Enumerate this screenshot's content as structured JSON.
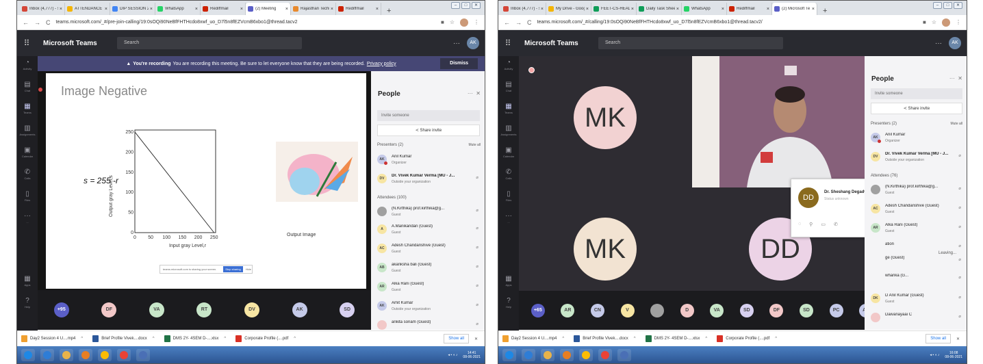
{
  "left": {
    "tabs": [
      {
        "label": "Inbox (4,777) - s",
        "color": "#d44638"
      },
      {
        "label": "ATTENDANCE S",
        "color": "#f4b400"
      },
      {
        "label": "DIP SESSION 2(",
        "color": "#4285f4"
      },
      {
        "label": "WhatsApp",
        "color": "#25d366"
      },
      {
        "label": "Rediffmail",
        "color": "#cc2200"
      },
      {
        "label": "(2) Meeting",
        "color": "#5b5fc7",
        "active": true
      },
      {
        "label": "Rajasthan Techi",
        "color": "#e88a2e"
      },
      {
        "label": "Rediffmail",
        "color": "#cc2200"
      }
    ],
    "url": "teams.microsoft.com/_#/pre-join-calling/19:0sOQi90NeBfFHTHcdo8xwf_uo_D7l5n8fEZVcmB6xbo1@thread.tacv2",
    "brand": "Microsoft Teams",
    "search": "Search",
    "me": "AK",
    "rail": [
      "Activity",
      "Chat",
      "Teams",
      "Assignments",
      "Calendar",
      "Calls",
      "Files",
      "...",
      "Apps",
      "Help"
    ],
    "banner": {
      "strong": "You're recording",
      "text": "You are recording this meeting. Be sure to let everyone know that they are being recorded.",
      "link": "Privacy policy",
      "dismiss": "Dismiss"
    },
    "slide": {
      "title": "Image Negative",
      "formula": "s = 255 -r",
      "xlabel": "Input gray Level,r",
      "ylabel": "Output gray Level,s",
      "output_caption": "Output Image",
      "share_text": "teams.microsoft.com is sharing your screen.",
      "stop": "Stop sharing",
      "hide": "Hide"
    },
    "chart_data": {
      "type": "line",
      "x": [
        0,
        250
      ],
      "y": [
        250,
        0
      ],
      "xticks": [
        "0",
        "50",
        "100",
        "150",
        "200",
        "250"
      ],
      "yticks": [
        "0",
        "50",
        "100",
        "150",
        "200",
        "250"
      ],
      "xlabel": "Input gray Level,r",
      "ylabel": "Output gray Level,s",
      "xlim": [
        0,
        255
      ],
      "ylim": [
        0,
        255
      ]
    },
    "avatars": [
      {
        "t": "+95",
        "c": "#5b5fc7"
      },
      {
        "t": "DF",
        "c": "#f2c8c8"
      },
      {
        "t": "VA",
        "c": "#c8e6c9"
      },
      {
        "t": "RT",
        "c": "#c8e6c9"
      },
      {
        "t": "DV",
        "c": "#f7e5a3"
      },
      {
        "t": "AK",
        "c": "#c5cae9"
      },
      {
        "t": "SD",
        "c": "#d7d0f0"
      }
    ],
    "people": {
      "title": "People",
      "invite": "Invite someone",
      "share": "Share invite",
      "presenters": "Presenters (2)",
      "muteall": "Mute all",
      "attendees": "Attendees (100)",
      "list": [
        {
          "i": "AK",
          "n": "Anil Kumar",
          "s": "Organizer",
          "c": "#c5cae9"
        },
        {
          "i": "DV",
          "n": "Dr. Vivek Kumar Verma [MU - J...",
          "s": "Outside your organization",
          "c": "#f7e5a3"
        },
        {
          "i": "",
          "n": "(N.Kirthika) prof.kirthika@g...",
          "s": "Guest",
          "c": "#a0a0a0"
        },
        {
          "i": "A",
          "n": "A.Manikandan (Guest)",
          "s": "Guest",
          "c": "#f7e5a3"
        },
        {
          "i": "AC",
          "n": "Adesh Chandanshive (Guest)",
          "s": "Guest",
          "c": "#f7e5a3"
        },
        {
          "i": "AB",
          "n": "akanksha bali (Guest)",
          "s": "Guest",
          "c": "#c8e6c9"
        },
        {
          "i": "AR",
          "n": "Alka Rani (Guest)",
          "s": "Guest",
          "c": "#c8e6c9"
        },
        {
          "i": "AK",
          "n": "Amit Kumar",
          "s": "Outside your organization",
          "c": "#c5cae9"
        },
        {
          "i": "",
          "n": "ankita sonam (Guest)",
          "s": "",
          "c": "#f2c8c8"
        }
      ]
    },
    "downloads": [
      {
        "n": "Day2 Session 4 U....mp4",
        "c": "#f0a030"
      },
      {
        "n": "Brief Profile Vivek....docx",
        "c": "#2b579a"
      },
      {
        "n": "DMS 2Y- 4SEM D-....xlsx",
        "c": "#217346"
      },
      {
        "n": "Corporate Profile (....pdf",
        "c": "#d93025"
      }
    ],
    "showall": "Show all",
    "clock": {
      "time": "14:41",
      "date": "08-06-2021"
    }
  },
  "right": {
    "tabs": [
      {
        "label": "Inbox (4,777) - sand",
        "color": "#d44638"
      },
      {
        "label": "My Drive - Google",
        "color": "#f4b400"
      },
      {
        "label": "FEET-CS-HEADCOU",
        "color": "#0f9d58"
      },
      {
        "label": "Daily Task Sheet(2",
        "color": "#0f9d58"
      },
      {
        "label": "WhatsApp",
        "color": "#25d366"
      },
      {
        "label": "Rediffmail",
        "color": "#cc2200"
      },
      {
        "label": "(2) Microsoft Te",
        "color": "#5b5fc7",
        "active": true
      }
    ],
    "url": "teams.microsoft.com/_#/calling/19:0sOQi90NeBfFHTHcdo8xwf_uo_D7l5n8fEZVcmB6xbo1@thread.tacv2/",
    "brand": "Microsoft Teams",
    "search": "Search",
    "tiles": [
      "MK",
      "MK",
      "DD"
    ],
    "popup": {
      "i": "DD",
      "n": "Dr. Sheshang Degadwal...",
      "s": "Status unknown"
    },
    "avatars": [
      {
        "t": "+65",
        "c": "#5b5fc7"
      },
      {
        "t": "AR",
        "c": "#c8e6c9"
      },
      {
        "t": "CN",
        "c": "#c5cae9"
      },
      {
        "t": "V",
        "c": "#f7e5a3"
      },
      {
        "t": "",
        "c": "#a0a0a0"
      },
      {
        "t": "D",
        "c": "#f2c8c8"
      },
      {
        "t": "VA",
        "c": "#c8e6c9"
      },
      {
        "t": "SD",
        "c": "#d7d0f0"
      },
      {
        "t": "DF",
        "c": "#f2c8c8"
      },
      {
        "t": "SD",
        "c": "#c8e6c9"
      },
      {
        "t": "PC",
        "c": "#c5cae9"
      },
      {
        "t": "AK",
        "c": "#c5cae9"
      }
    ],
    "people": {
      "title": "People",
      "invite": "Invite someone",
      "share": "Share invite",
      "presenters": "Presenters (2)",
      "muteall": "Mute all",
      "attendees": "Attendees (76)",
      "leaving": "Leaving...",
      "list": [
        {
          "i": "AK",
          "n": "Anil Kumar",
          "s": "Organizer",
          "c": "#c5cae9"
        },
        {
          "i": "DV",
          "n": "Dr. Vivek Kumar Verma [MU - J...",
          "s": "Outside your organization",
          "c": "#f7e5a3"
        },
        {
          "i": "",
          "n": "(N.Kirthika) prof.kirthika@g...",
          "s": "Guest",
          "c": "#a0a0a0"
        },
        {
          "i": "AC",
          "n": "Adesh Chandanshive (Guest)",
          "s": "Guest",
          "c": "#f7e5a3"
        },
        {
          "i": "AR",
          "n": "Alka Rani (Guest)",
          "s": "Guest",
          "c": "#c8e6c9"
        },
        {
          "i": "",
          "n": "ation",
          "s": "",
          "c": "#f4f4f6"
        },
        {
          "i": "",
          "n": "ge (Guest)",
          "s": "",
          "c": "#f4f4f6"
        },
        {
          "i": "",
          "n": "wharika (G...",
          "s": "",
          "c": "#f4f4f6"
        },
        {
          "i": "DK",
          "n": "D Anil Kumar (Guest)",
          "s": "Guest",
          "c": "#f7e5a3"
        },
        {
          "i": "",
          "n": "Daivanayaai C",
          "s": "",
          "c": "#f2c8c8"
        }
      ]
    },
    "downloads": [
      {
        "n": "Day2 Session 4 U....mp4",
        "c": "#f0a030"
      },
      {
        "n": "Brief Profile Vivek....docx",
        "c": "#2b579a"
      },
      {
        "n": "DMS 2Y- 4SEM D-....xlsx",
        "c": "#217346"
      },
      {
        "n": "Corporate Profile (....pdf",
        "c": "#d93025"
      }
    ],
    "showall": "Show all",
    "clock": {
      "time": "16:08",
      "date": "08-06-2021"
    }
  },
  "icons": {
    "search": "search-icon",
    "more": "more-icon",
    "close": "close-icon",
    "mic": "mic-off-icon"
  }
}
